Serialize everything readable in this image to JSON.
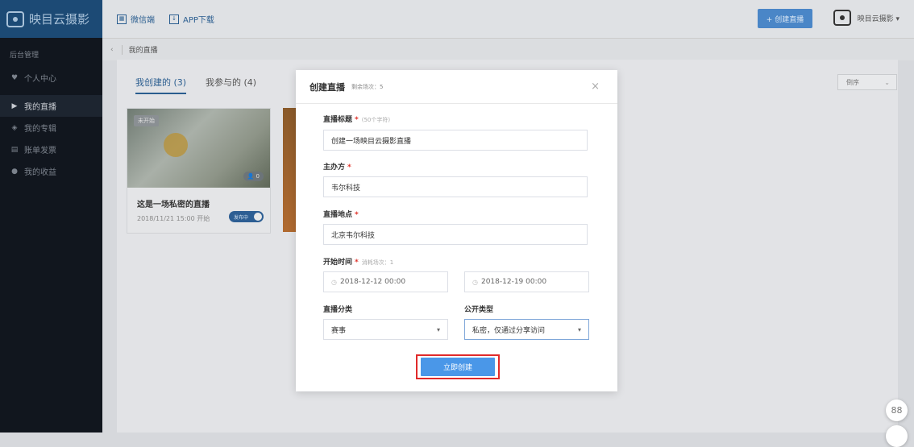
{
  "sidebar": {
    "logo_text": "映目云摄影",
    "section": "后台管理",
    "items": [
      {
        "label": "个人中心",
        "icon": "heart-icon"
      },
      {
        "label": "我的直播",
        "icon": "play-icon"
      },
      {
        "label": "我的专辑",
        "icon": "album-icon"
      },
      {
        "label": "账单发票",
        "icon": "invoice-icon"
      },
      {
        "label": "我的收益",
        "icon": "income-icon"
      }
    ]
  },
  "topbar": {
    "wechat_label": "微信端",
    "app_label": "APP下载",
    "create_label": "+ 创建直播",
    "user_name": "映目云摄影 ▾"
  },
  "breadcrumb": {
    "back": "‹",
    "current": "我的直播"
  },
  "main": {
    "tabs": [
      "我创建的 (3)",
      "我参与的 (4)"
    ],
    "sort_label": "倒序",
    "card": {
      "badge": "未开始",
      "viewers": "👤 0",
      "title": "这是一场私密的直播",
      "time": "2018/11/21 15:00 开始",
      "status": "发布中"
    }
  },
  "modal": {
    "title": "创建直播",
    "subtitle": "剩余场次：5",
    "close": "×",
    "title_label": "直播标题",
    "title_hint": "(50个字符)",
    "title_value": "创建一场映目云摄影直播",
    "host_label": "主办方",
    "host_value": "韦尔科技",
    "location_label": "直播地点",
    "location_value": "北京韦尔科技",
    "start_label": "开始时间",
    "start_hint": "消耗场次：1",
    "start_value": "2018-12-12 00:00",
    "end_value": "2018-12-19 00:00",
    "category_label": "直播分类",
    "category_value": "赛事",
    "privacy_label": "公开类型",
    "privacy_value": "私密，仅通过分享访问",
    "submit_label": "立即创建"
  },
  "float": {
    "icon_text": "88"
  }
}
